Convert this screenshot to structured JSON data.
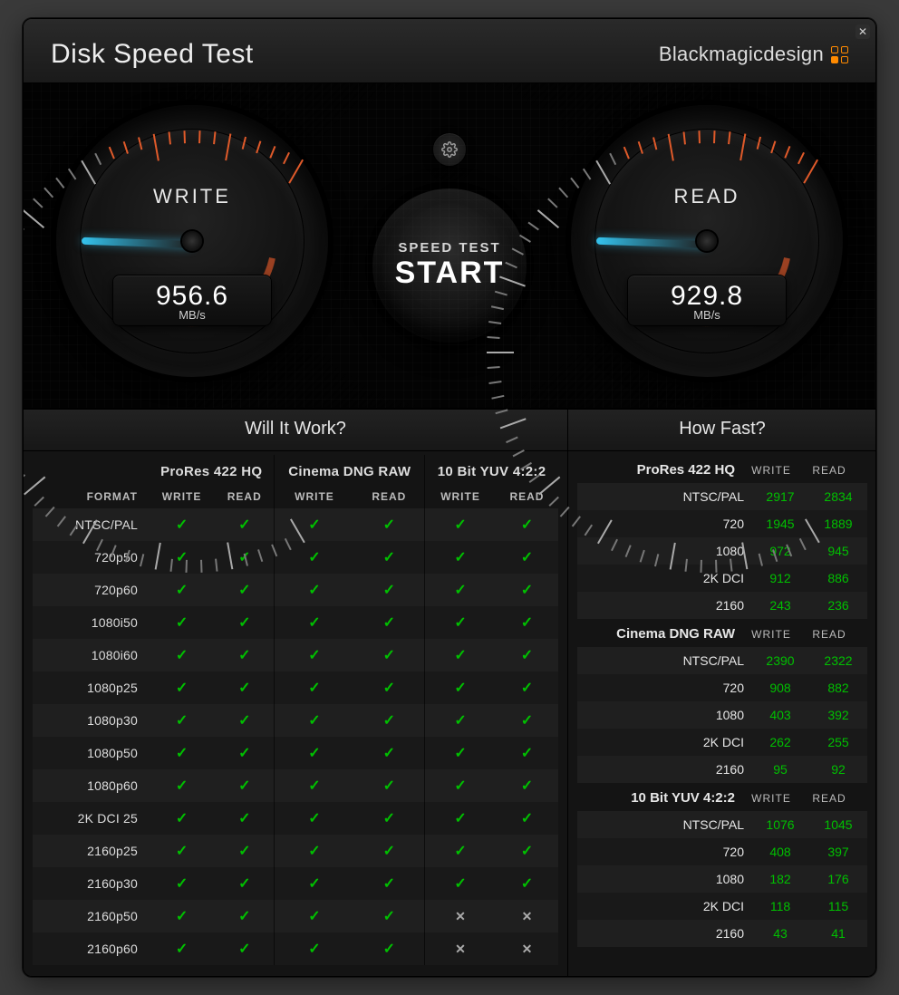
{
  "header": {
    "title": "Disk Speed Test",
    "brand": "Blackmagicdesign"
  },
  "controls": {
    "settings_tooltip": "Settings",
    "start_line1": "SPEED TEST",
    "start_line2": "START"
  },
  "gauges": {
    "write": {
      "label": "WRITE",
      "value": "956.6",
      "unit": "MB/s",
      "needle_angle": 182
    },
    "read": {
      "label": "READ",
      "value": "929.8",
      "unit": "MB/s",
      "needle_angle": 182
    }
  },
  "will_it_work": {
    "title": "Will It Work?",
    "format_header": "FORMAT",
    "codecs": [
      "ProRes 422 HQ",
      "Cinema DNG RAW",
      "10 Bit YUV 4:2:2"
    ],
    "sub": [
      "WRITE",
      "READ"
    ],
    "rows": [
      {
        "format": "NTSC/PAL",
        "cells": [
          true,
          true,
          true,
          true,
          true,
          true
        ]
      },
      {
        "format": "720p50",
        "cells": [
          true,
          true,
          true,
          true,
          true,
          true
        ]
      },
      {
        "format": "720p60",
        "cells": [
          true,
          true,
          true,
          true,
          true,
          true
        ]
      },
      {
        "format": "1080i50",
        "cells": [
          true,
          true,
          true,
          true,
          true,
          true
        ]
      },
      {
        "format": "1080i60",
        "cells": [
          true,
          true,
          true,
          true,
          true,
          true
        ]
      },
      {
        "format": "1080p25",
        "cells": [
          true,
          true,
          true,
          true,
          true,
          true
        ]
      },
      {
        "format": "1080p30",
        "cells": [
          true,
          true,
          true,
          true,
          true,
          true
        ]
      },
      {
        "format": "1080p50",
        "cells": [
          true,
          true,
          true,
          true,
          true,
          true
        ]
      },
      {
        "format": "1080p60",
        "cells": [
          true,
          true,
          true,
          true,
          true,
          true
        ]
      },
      {
        "format": "2K DCI 25",
        "cells": [
          true,
          true,
          true,
          true,
          true,
          true
        ]
      },
      {
        "format": "2160p25",
        "cells": [
          true,
          true,
          true,
          true,
          true,
          true
        ]
      },
      {
        "format": "2160p30",
        "cells": [
          true,
          true,
          true,
          true,
          true,
          true
        ]
      },
      {
        "format": "2160p50",
        "cells": [
          true,
          true,
          true,
          true,
          false,
          false
        ]
      },
      {
        "format": "2160p60",
        "cells": [
          true,
          true,
          true,
          true,
          false,
          false
        ]
      }
    ]
  },
  "how_fast": {
    "title": "How Fast?",
    "cols": [
      "WRITE",
      "READ"
    ],
    "sections": [
      {
        "codec": "ProRes 422 HQ",
        "rows": [
          {
            "res": "NTSC/PAL",
            "write": 2917,
            "read": 2834
          },
          {
            "res": "720",
            "write": 1945,
            "read": 1889
          },
          {
            "res": "1080",
            "write": 972,
            "read": 945
          },
          {
            "res": "2K DCI",
            "write": 912,
            "read": 886
          },
          {
            "res": "2160",
            "write": 243,
            "read": 236
          }
        ]
      },
      {
        "codec": "Cinema DNG RAW",
        "rows": [
          {
            "res": "NTSC/PAL",
            "write": 2390,
            "read": 2322
          },
          {
            "res": "720",
            "write": 908,
            "read": 882
          },
          {
            "res": "1080",
            "write": 403,
            "read": 392
          },
          {
            "res": "2K DCI",
            "write": 262,
            "read": 255
          },
          {
            "res": "2160",
            "write": 95,
            "read": 92
          }
        ]
      },
      {
        "codec": "10 Bit YUV 4:2:2",
        "rows": [
          {
            "res": "NTSC/PAL",
            "write": 1076,
            "read": 1045
          },
          {
            "res": "720",
            "write": 408,
            "read": 397
          },
          {
            "res": "1080",
            "write": 182,
            "read": 176
          },
          {
            "res": "2K DCI",
            "write": 118,
            "read": 115
          },
          {
            "res": "2160",
            "write": 43,
            "read": 41
          }
        ]
      }
    ]
  }
}
